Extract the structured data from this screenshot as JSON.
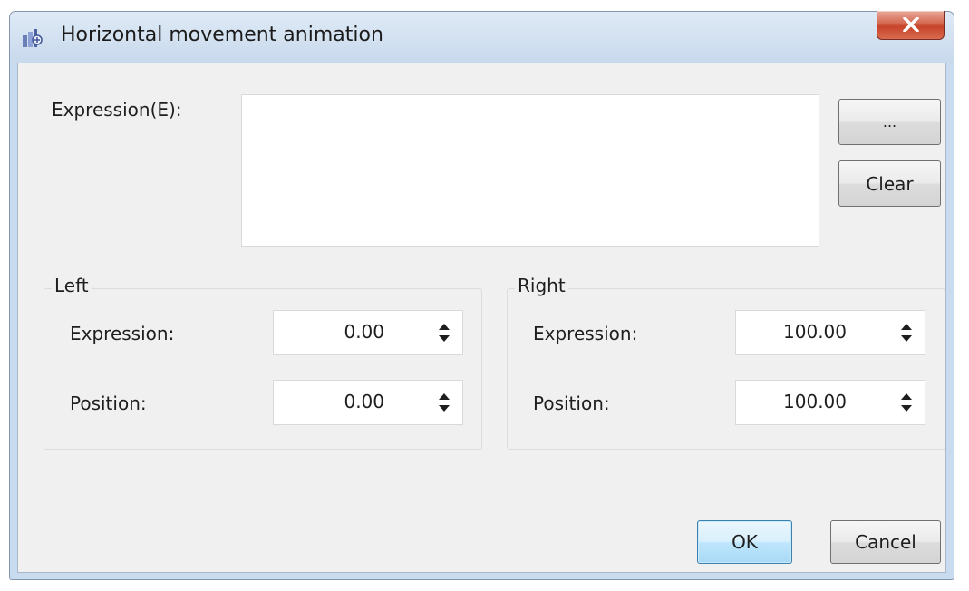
{
  "window": {
    "title": "Horizontal movement animation",
    "close_glyph": "X",
    "icon": "app-icon"
  },
  "expression": {
    "label": "Expression(E):",
    "value": "",
    "browse_label": "...",
    "clear_label": "Clear"
  },
  "left": {
    "title": "Left",
    "expression_label": "Expression:",
    "expression_value": "0.00",
    "position_label": "Position:",
    "position_value": "0.00"
  },
  "right": {
    "title": "Right",
    "expression_label": "Expression:",
    "expression_value": "100.00",
    "position_label": "Position:",
    "position_value": "100.00"
  },
  "buttons": {
    "ok_label": "OK",
    "cancel_label": "Cancel"
  },
  "colors": {
    "titlebar": "#c9dbee",
    "close": "#c7432a",
    "client": "#f0f0f0",
    "default_button_border": "#3c7fb1"
  }
}
